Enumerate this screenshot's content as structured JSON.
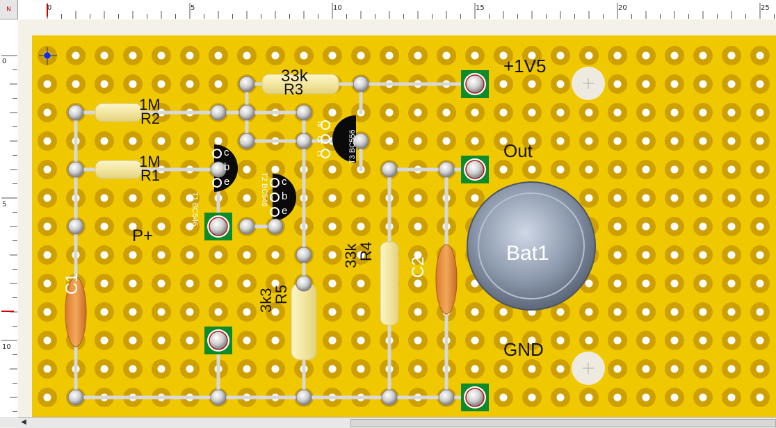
{
  "ruler": {
    "corner_label": "N",
    "top_ticks": [
      "0",
      "5",
      "10",
      "15",
      "20",
      "25"
    ],
    "left_ticks": [
      "0",
      "5",
      "10"
    ]
  },
  "board": {
    "board_color": "#f0c800",
    "pad_ring_color": "#cda000",
    "hole_color": "#ffffff",
    "trace_color": "#d8d8d8",
    "terminal_color": "#0e8a2a"
  },
  "labels": {
    "r1_value": "1M",
    "r1_name": "R1",
    "r2_value": "1M",
    "r2_name": "R2",
    "r3_value": "33k",
    "r3_name": "R3",
    "r4_value": "33k",
    "r4_name": "R4",
    "r5_value": "3k3",
    "r5_name": "R5",
    "c1_name": "C1",
    "c2_name": "C2",
    "t1_text": "T1 BC546",
    "t2_text": "T2 BC546",
    "t3_text": "T3 BC556",
    "pin_c": "c",
    "pin_b": "b",
    "pin_e": "e",
    "bat_name": "Bat1",
    "plus_label": "P+",
    "v_label": "+1V5",
    "out_label": "Out",
    "gnd_label": "GND"
  }
}
